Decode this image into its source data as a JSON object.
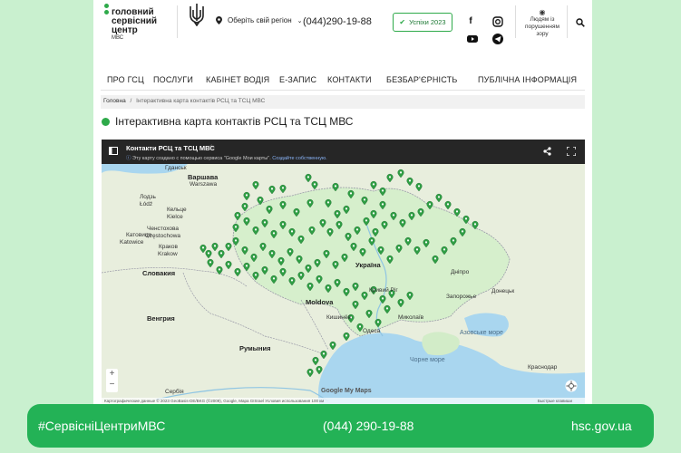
{
  "logo": {
    "line1": "головний",
    "line2": "сервісний",
    "line3": "центр",
    "sub": "МВС"
  },
  "header": {
    "region_label": "Оберіть свій регіон",
    "phone": "(044)290-19-88",
    "uspikhy_label": "Успіхи 2023",
    "vision_label": "Людям із порушенням зору",
    "icons": [
      "trident-icon",
      "location-pin-icon",
      "check-icon",
      "facebook-icon",
      "instagram-icon",
      "youtube-icon",
      "telegram-icon",
      "eye-icon",
      "search-icon"
    ]
  },
  "nav": {
    "items": [
      "ПРО ГСЦ",
      "ПОСЛУГИ",
      "КАБІНЕТ ВОДІЯ",
      "Е-ЗАПИС",
      "КОНТАКТИ",
      "БЕЗБАР'ЄРНІСТЬ",
      "ПУБЛІЧНА ІНФОРМАЦІЯ"
    ]
  },
  "breadcrumb": {
    "home": "Головна",
    "separator": "/",
    "current": "Інтерактивна карта контактів РСЦ та ТСЦ МВС"
  },
  "page_title": "Інтерактивна карта контактів РСЦ та ТСЦ МВС",
  "map": {
    "title": "Контакти РСЦ та ТСЦ МВС",
    "subtitle": "Эту карту создано с помощью сервиса \"Google Мои карты\".",
    "subtitle_link": "Создайте собственную.",
    "marker_color": "#2f9e44",
    "cities": [
      "Варшава",
      "Warszawa",
      "Гданськ",
      "Лодзь",
      "Łódź",
      "Кельце",
      "Kielce",
      "Катовице",
      "Katowice",
      "Krakow",
      "Краков",
      "Ченстохова",
      "Częstochowa",
      "Словакия",
      "Венгрия",
      "Moldova",
      "Кишинёв",
      "Румыния",
      "Україна",
      "Дніпро",
      "Запорожье",
      "Одеса",
      "Кривий Ріг",
      "Миколаїв",
      "Донецьк",
      "Краснодар",
      "Сербія",
      "Болгарія",
      "Кропивницький",
      "Херсон",
      "Мариуполь",
      "Ставрополь",
      "Ростов-на-Дону",
      "Азовське море",
      "Чорне море",
      "Крим"
    ],
    "zoom_in": "+",
    "zoom_out": "−",
    "google_label": "Google My Maps",
    "attribution": "Картографические данные © 2023 GeoBasis-DE/BKG (©2009), Google, Mapa GISrael   Условия использования   100 км",
    "shortcuts": "Быстрые клавиши"
  },
  "banner": {
    "hashtag": "#СервісніЦентриМВС",
    "phone": "(044) 290-19-88",
    "site": "hsc.gov.ua"
  },
  "colors": {
    "accent": "#2eaa4a",
    "banner": "#23b256",
    "background": "#c9f0cf"
  }
}
